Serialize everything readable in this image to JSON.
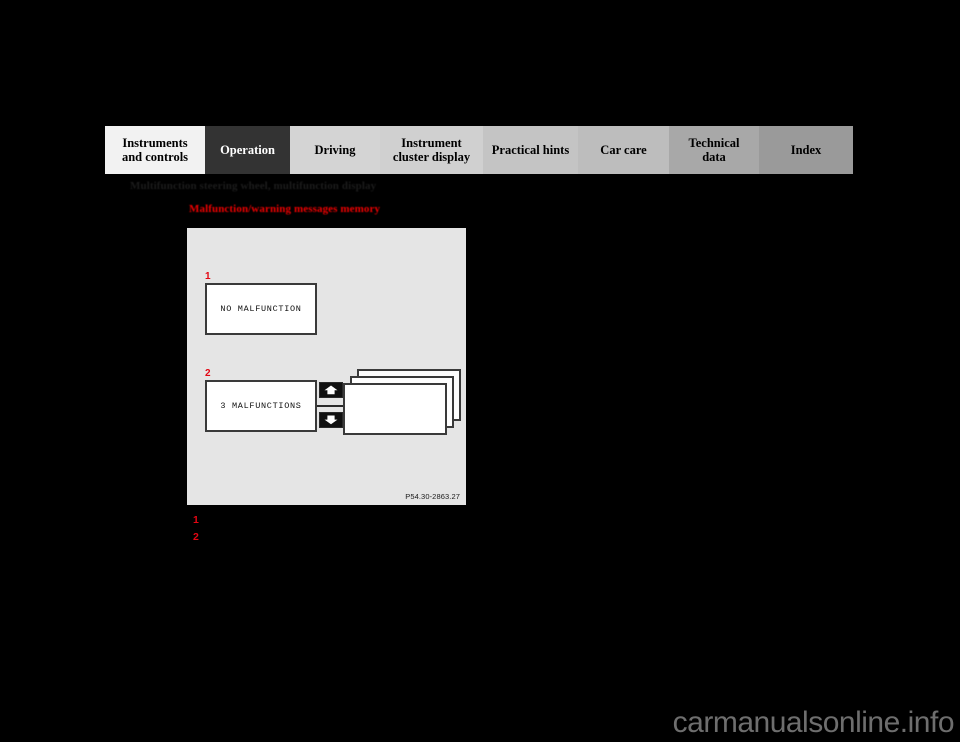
{
  "page": {
    "background_color": "#000000",
    "watermark": "carmanualsonline.info"
  },
  "tabbar": {
    "tabs": [
      {
        "label": "Instruments\nand controls",
        "active": false,
        "bg": "#f2f2f2"
      },
      {
        "label": "Operation",
        "active": true,
        "bg": "#333333"
      },
      {
        "label": "Driving",
        "active": false,
        "bg": "#d4d4d4"
      },
      {
        "label": "Instrument\ncluster display",
        "active": false,
        "bg": "#d0d0d0"
      },
      {
        "label": "Practical hints",
        "active": false,
        "bg": "#c4c4c4"
      },
      {
        "label": "Car care",
        "active": false,
        "bg": "#bdbdbd"
      },
      {
        "label": "Technical\ndata",
        "active": false,
        "bg": "#a8a8a8"
      },
      {
        "label": "Index",
        "active": false,
        "bg": "#9a9a9a"
      }
    ]
  },
  "headings": {
    "section_title": "Multifunction steering wheel, multifunction display",
    "sub_title": "Malfunction/warning messages memory",
    "sub_title_color": "#ee0000"
  },
  "figure": {
    "code": "P54.30-2863.27",
    "background_color": "#e5e5e5",
    "callouts": [
      {
        "number": "1",
        "color": "#e30613"
      },
      {
        "number": "2",
        "color": "#e30613"
      }
    ],
    "displays": [
      {
        "id": "no-malfunction",
        "text": "NO MALFUNCTION"
      },
      {
        "id": "three-malfunctions",
        "text": "3 MALFUNCTIONS"
      }
    ],
    "buttons": [
      {
        "id": "scroll-up",
        "icon": "arrow-up-icon"
      },
      {
        "id": "scroll-down",
        "icon": "arrow-down-icon"
      }
    ],
    "stack": {
      "count": 3,
      "text": ""
    }
  },
  "legend": {
    "items": [
      {
        "number": "1",
        "text": ""
      },
      {
        "number": "2",
        "text": ""
      }
    ]
  }
}
